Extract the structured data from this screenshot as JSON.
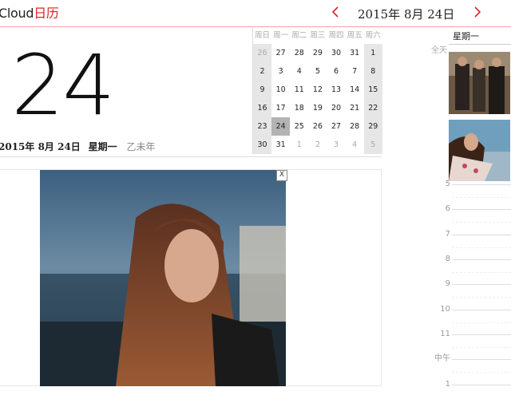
{
  "header": {
    "app_name": "Cloud",
    "app_name_cal": "日历",
    "prev_icon": "chevron-left-icon",
    "next_icon": "chevron-right-icon",
    "current_date": "2015年  8月  24日",
    "accent": "#d9252a"
  },
  "today": {
    "day": "24",
    "date_text": "2015年  8月  24日",
    "weekday": "星期一",
    "lunar_year": "乙未年"
  },
  "mini_calendar": {
    "weekdays": [
      "周日",
      "周一",
      "周二",
      "周三",
      "周四",
      "周五",
      "周六"
    ],
    "weeks": [
      [
        "26",
        "27",
        "28",
        "29",
        "30",
        "31",
        "1"
      ],
      [
        "2",
        "3",
        "4",
        "5",
        "6",
        "7",
        "8"
      ],
      [
        "9",
        "10",
        "11",
        "12",
        "13",
        "14",
        "15"
      ],
      [
        "16",
        "17",
        "18",
        "19",
        "20",
        "21",
        "22"
      ],
      [
        "23",
        "24",
        "25",
        "26",
        "27",
        "28",
        "29"
      ],
      [
        "30",
        "31",
        "1",
        "2",
        "3",
        "4",
        "5"
      ]
    ],
    "selected": "24"
  },
  "ad": {
    "close_label": "X"
  },
  "day_view": {
    "weekday": "星期一",
    "all_day_label": "全天",
    "hours": [
      "5",
      "6",
      "7",
      "8",
      "9",
      "10",
      "11",
      "中午",
      "1"
    ]
  }
}
